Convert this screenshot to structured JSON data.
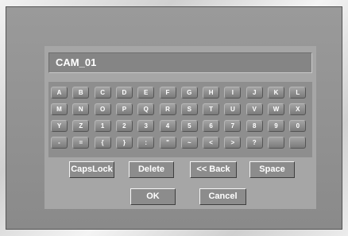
{
  "name_field": {
    "value": "CAM_01"
  },
  "keyboard": {
    "rows": [
      [
        "A",
        "B",
        "C",
        "D",
        "E",
        "F",
        "G",
        "H",
        "I",
        "J",
        "K",
        "L"
      ],
      [
        "M",
        "N",
        "O",
        "P",
        "Q",
        "R",
        "S",
        "T",
        "U",
        "V",
        "W",
        "X"
      ],
      [
        "Y",
        "Z",
        "1",
        "2",
        "3",
        "4",
        "5",
        "6",
        "7",
        "8",
        "9",
        "0"
      ],
      [
        "-",
        "=",
        "{",
        "}",
        ":",
        "\"",
        "~",
        "<",
        ">",
        "?",
        "",
        ""
      ]
    ]
  },
  "actions": {
    "capslock": "CapsLock",
    "delete": "Delete",
    "back": "<< Back",
    "space": "Space"
  },
  "dialog": {
    "ok": "OK",
    "cancel": "Cancel"
  }
}
